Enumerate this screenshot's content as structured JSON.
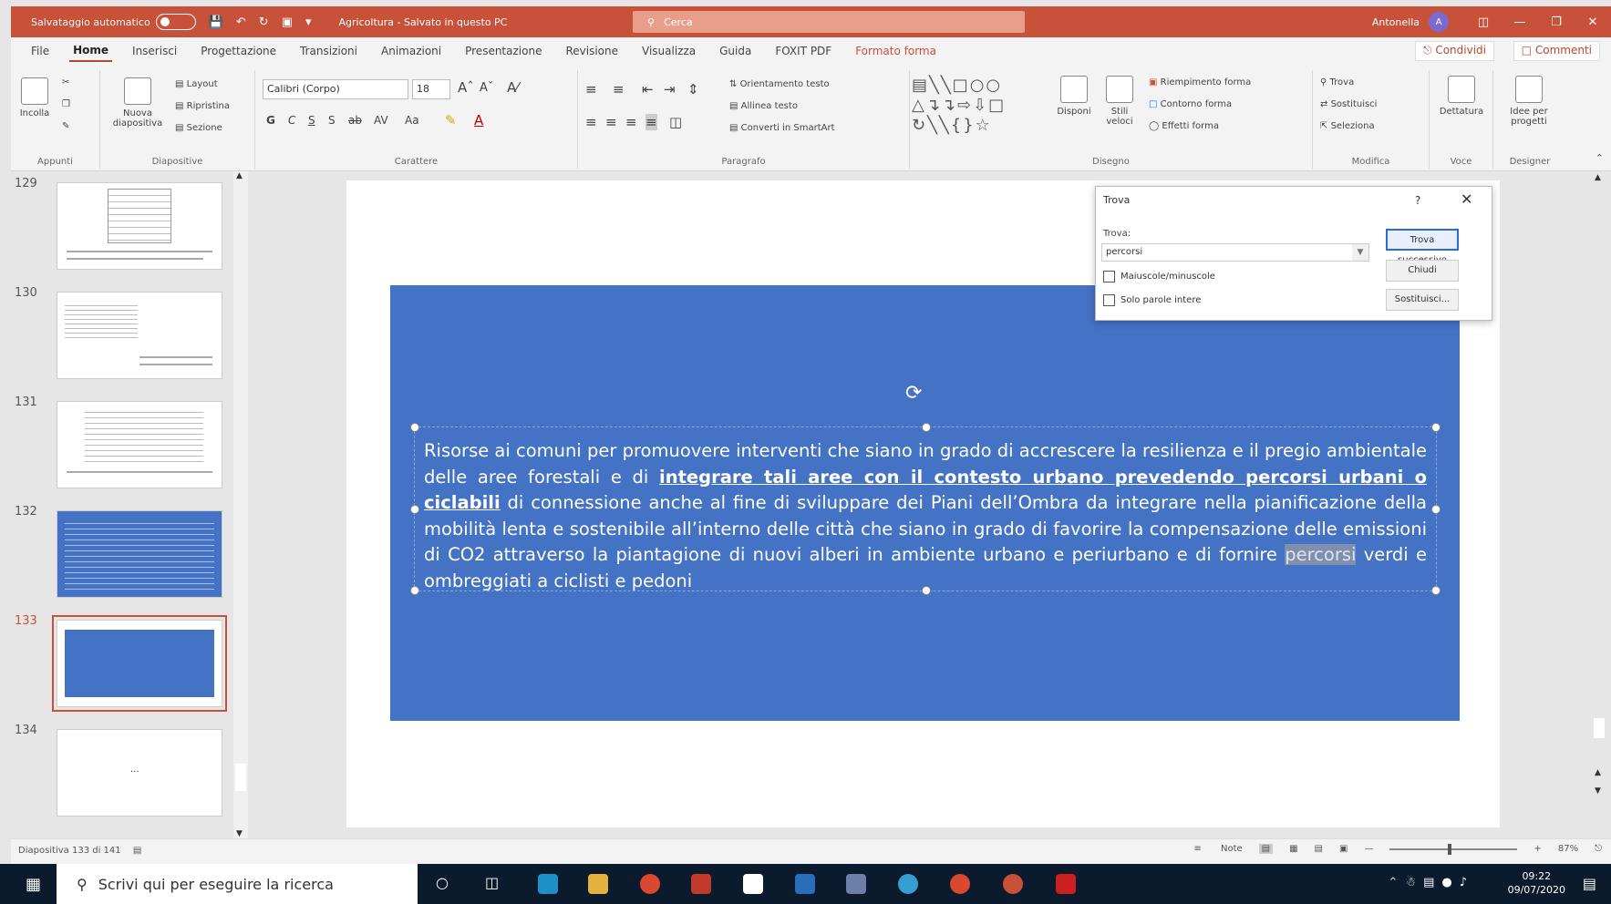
{
  "titlebar": {
    "autosave_label": "Salvataggio automatico",
    "document_title": "Agricoltura - Salvato in questo PC",
    "search_placeholder": "Cerca",
    "user_name": "Antonella",
    "user_initial": "A",
    "accent_color": "#c8513a"
  },
  "menu": {
    "tabs": [
      "File",
      "Home",
      "Inserisci",
      "Progettazione",
      "Transizioni",
      "Animazioni",
      "Presentazione",
      "Revisione",
      "Visualizza",
      "Guida",
      "FOXIT PDF",
      "Formato forma"
    ],
    "active": "Home",
    "share_label": "Condividi",
    "comments_label": "Commenti"
  },
  "ribbon": {
    "appunti": {
      "label": "Appunti",
      "paste": "Incolla"
    },
    "diapositive": {
      "label": "Diapositive",
      "new_slide": "Nuova diapositiva",
      "layout": "Layout",
      "reset": "Ripristina",
      "section": "Sezione"
    },
    "carattere": {
      "label": "Carattere",
      "font": "Calibri (Corpo)",
      "size": "18",
      "bold": "G",
      "italic": "C",
      "underline": "S",
      "shadow": "S",
      "case": "Aa"
    },
    "paragrafo": {
      "label": "Paragrafo",
      "text_direction": "Orientamento testo",
      "align_text": "Allinea testo",
      "smartart": "Converti in SmartArt"
    },
    "disegno": {
      "label": "Disegno",
      "arrange": "Disponi",
      "quick_styles": "Stili veloci",
      "fill": "Riempimento forma",
      "outline": "Contorno forma",
      "effects": "Effetti forma"
    },
    "modifica": {
      "label": "Modifica",
      "find": "Trova",
      "replace": "Sostituisci",
      "select": "Seleziona"
    },
    "voce": {
      "label": "Voce",
      "dictate": "Dettatura"
    },
    "designer": {
      "label": "Designer",
      "ideas": "Idee per progetti"
    }
  },
  "thumbnails": [
    {
      "num": "129",
      "style": "table"
    },
    {
      "num": "130",
      "style": "text"
    },
    {
      "num": "131",
      "style": "text"
    },
    {
      "num": "132",
      "style": "blue"
    },
    {
      "num": "133",
      "style": "blue",
      "selected": true
    },
    {
      "num": "134",
      "style": "blank",
      "text": "..."
    }
  ],
  "slide": {
    "box_color": "#4472c4",
    "text_part1": "Risorse ai comuni per promuovere interventi che siano in grado di accrescere la resilienza e il pregio ambientale delle aree forestali e di ",
    "text_underlined": "integrare tali aree con il contesto urbano prevedendo percorsi urbani o ciclabili",
    "text_part2": " di connessione anche al fine di sviluppare dei Piani dell’Ombra da integrare nella pianificazione della mobilità lenta e sostenibile all’interno delle città che siano in grado di favorire la compensazione delle emissioni di CO2 attraverso la piantagione di nuovi alberi in ambiente urbano e periurbano e di fornire ",
    "text_highlight": "percorsi",
    "text_part3": " verdi e ombreggiati a ciclisti e pedoni"
  },
  "find_dialog": {
    "title": "Trova",
    "help": "?",
    "find_label": "Trova:",
    "find_value": "percorsi",
    "match_case": "Maiuscole/minuscole",
    "whole_words": "Solo parole intere",
    "find_next": "Trova successivo",
    "close": "Chiudi",
    "replace": "Sostituisci..."
  },
  "status": {
    "slide_info": "Diapositiva 133 di 141",
    "notes": "Note",
    "zoom": "87%"
  },
  "taskbar": {
    "search_placeholder": "Scrivi qui per eseguire la ricerca",
    "time": "09:22",
    "date": "09/07/2020"
  }
}
